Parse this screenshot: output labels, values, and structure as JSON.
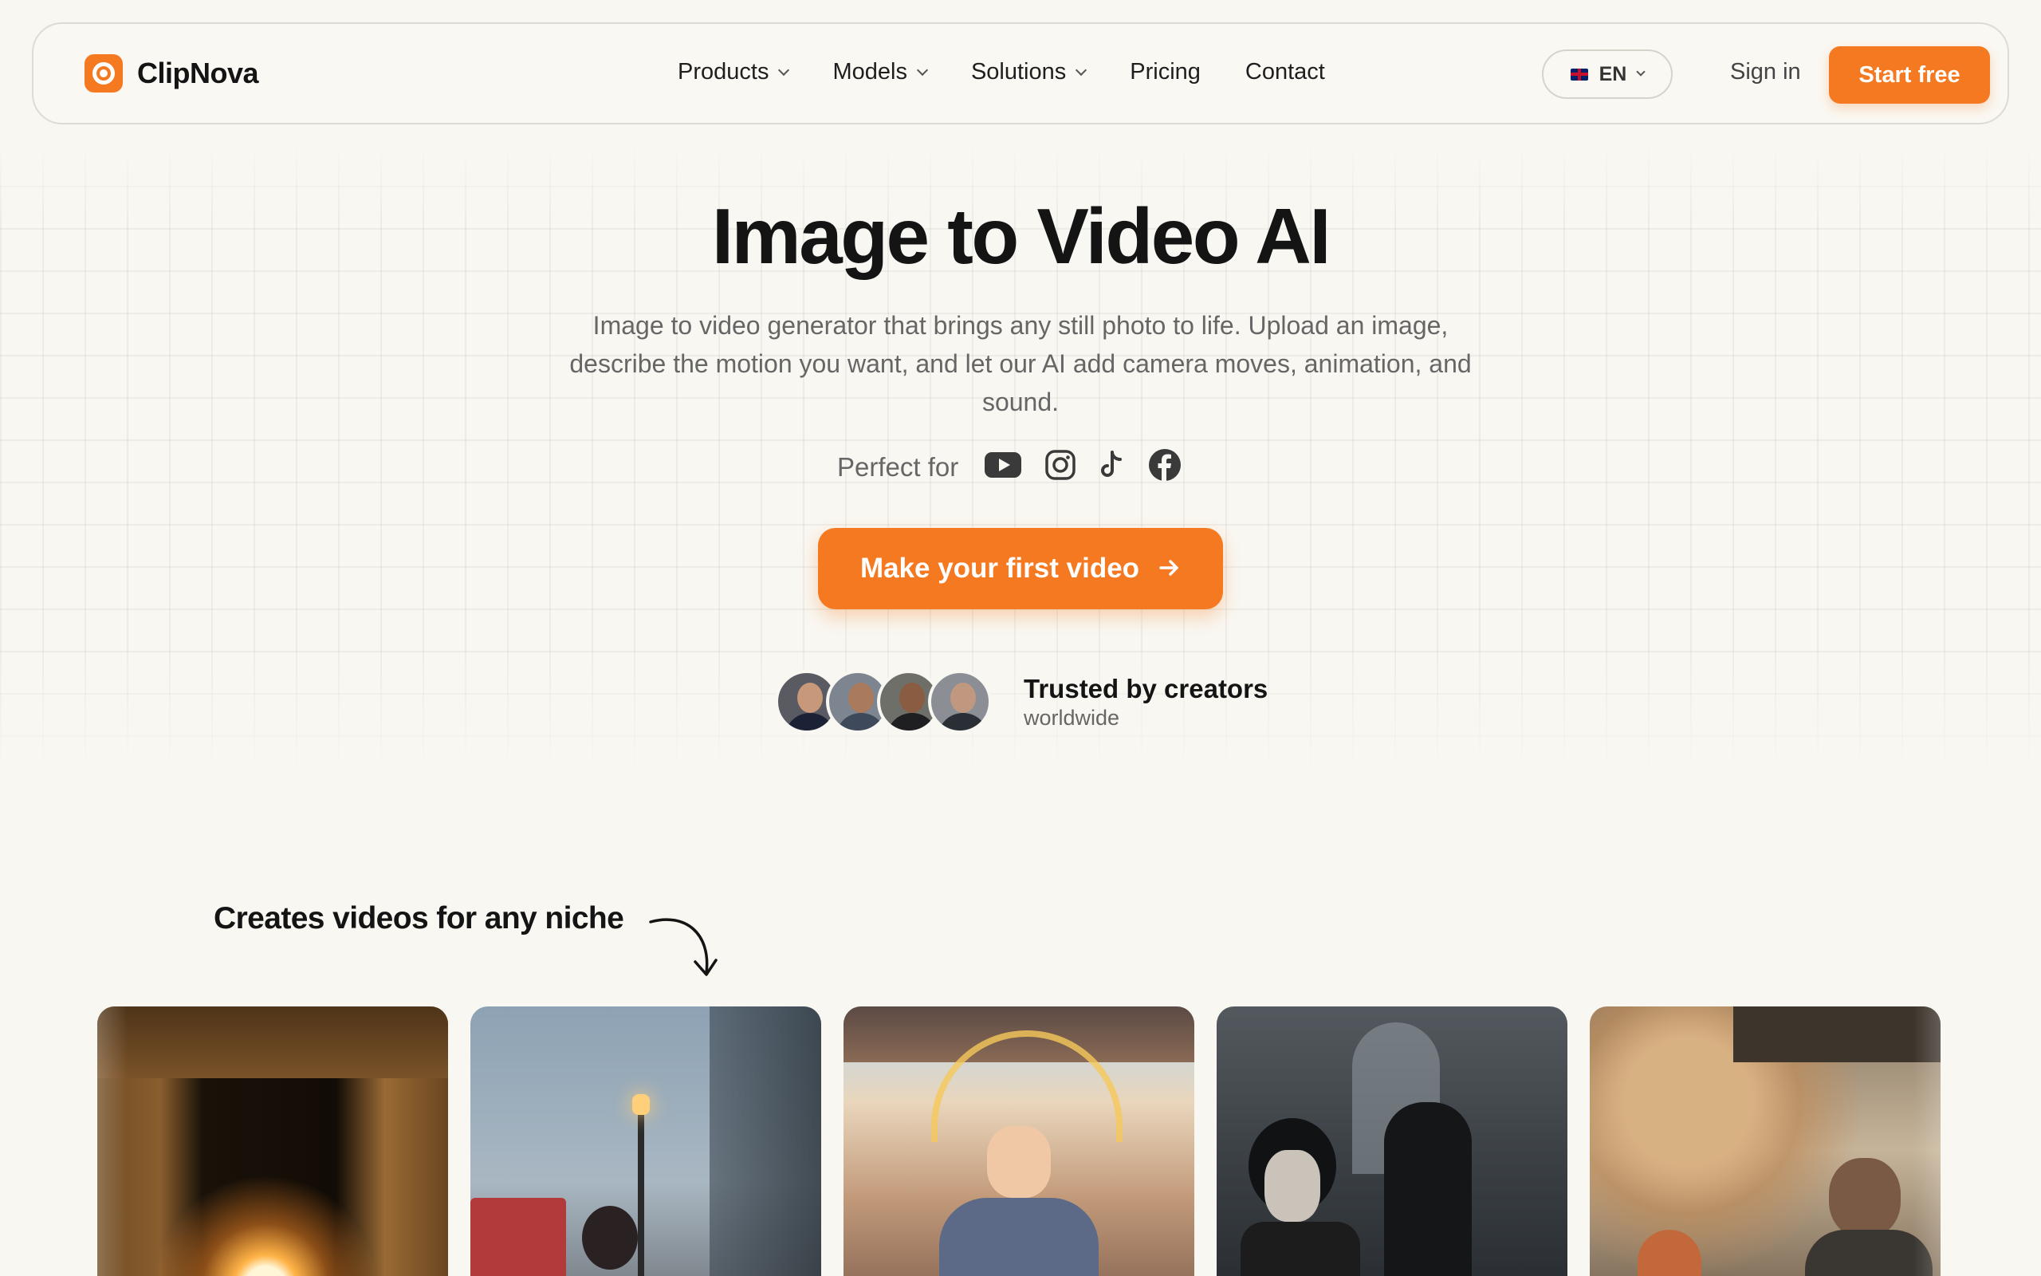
{
  "brand": {
    "name": "ClipNova",
    "accent": "#f47920"
  },
  "nav": {
    "items": [
      {
        "label": "Products",
        "has_dropdown": true
      },
      {
        "label": "Models",
        "has_dropdown": true
      },
      {
        "label": "Solutions",
        "has_dropdown": true
      },
      {
        "label": "Pricing",
        "has_dropdown": false
      },
      {
        "label": "Contact",
        "has_dropdown": false
      }
    ],
    "language": {
      "code": "EN",
      "flag": "uk-flag-icon"
    },
    "sign_in": "Sign in",
    "start_free": "Start free"
  },
  "hero": {
    "title": "Image to Video AI",
    "subtitle": "Image to video generator that brings any still photo to life. Upload an image, describe the motion you want, and let our AI add camera moves, animation, and sound.",
    "perfect_for_label": "Perfect for",
    "platforms": [
      "youtube-icon",
      "instagram-icon",
      "tiktok-icon",
      "facebook-icon"
    ],
    "cta_label": "Make your first video",
    "trust_title": "Trusted by creators",
    "trust_subtitle": "worldwide"
  },
  "niche": {
    "heading": "Creates videos for any niche",
    "cards": [
      {
        "name": "tomb-fire-scene"
      },
      {
        "name": "rainy-street-scene"
      },
      {
        "name": "anime-martial-artist-scene"
      },
      {
        "name": "gothic-lightning-scene"
      },
      {
        "name": "smoky-station-scene"
      }
    ]
  }
}
